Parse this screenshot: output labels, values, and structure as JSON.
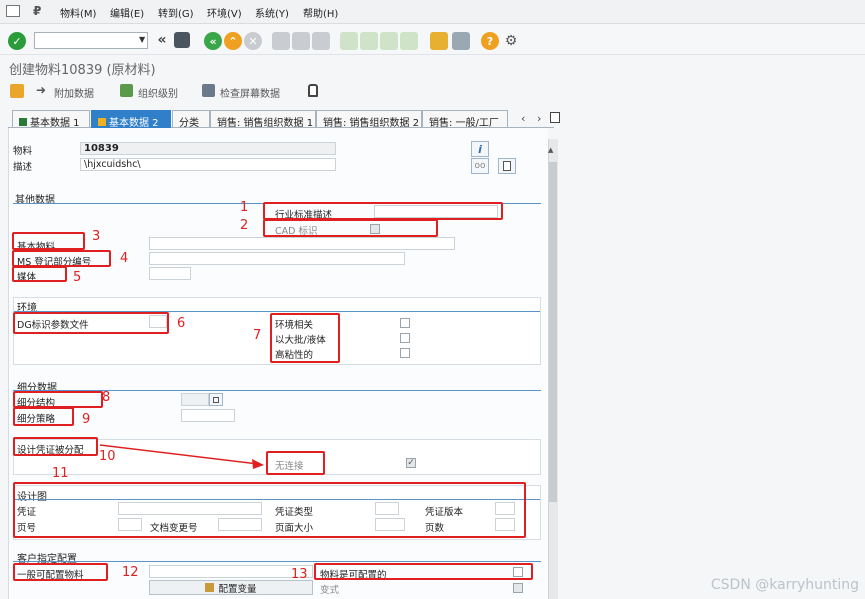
{
  "menu": {
    "items": [
      "物料(M)",
      "编辑(E)",
      "转到(G)",
      "环境(V)",
      "系统(Y)",
      "帮助(H)"
    ]
  },
  "window": {
    "title": "创建物料10839 (原材料)"
  },
  "app_toolbar": {
    "additional_data": "附加数据",
    "org_levels": "组织级别",
    "check_screen_data": "检查屏幕数据"
  },
  "tabs": [
    {
      "label": "基本数据 1",
      "active": false
    },
    {
      "label": "基本数据 2",
      "active": true
    },
    {
      "label": "分类",
      "active": false
    },
    {
      "label": "销售: 销售组织数据 1",
      "active": false
    },
    {
      "label": "销售: 销售组织数据 2",
      "active": false
    },
    {
      "label": "销售: 一般/工厂",
      "active": false
    }
  ],
  "header": {
    "material_label": "物料",
    "material_value": "10839",
    "desc_label": "描述",
    "desc_value": "\\hjxcuidshc\\"
  },
  "other_data": {
    "section_title": "其他数据",
    "industry_std_desc": "行业标准描述",
    "cad_indicator": "CAD 标识",
    "basic_material": "基本物料",
    "ms_book_part_no": "MS 登记部分编号",
    "medium": "媒体"
  },
  "environment": {
    "section_title": "环境",
    "dg_profile": "DG标识参数文件",
    "env_relevant": "环境相关",
    "highly_viscous_liquid": "以大批/液体",
    "highly_viscous": "高粘性的"
  },
  "segmentation": {
    "section_title": "细分数据",
    "structure": "细分结构",
    "strategy": "细分策略"
  },
  "design_doc": {
    "assigned_label": "设计凭证被分配",
    "no_link": "无连接",
    "checked": true
  },
  "design_drawing": {
    "section_title": "设计图",
    "document": "凭证",
    "doc_type": "凭证类型",
    "doc_version": "凭证版本",
    "page_no": "页号",
    "doc_change_no": "文档变更号",
    "page_format": "页面大小",
    "num_pages": "页数"
  },
  "client_config": {
    "section_title": "客户指定配置",
    "general_config_material": "一般可配置物料",
    "material_is_configurable": "物料是可配置的",
    "config_variant_btn": "配置变量",
    "variant": "变式"
  },
  "annotations": {
    "numbers": [
      "1",
      "2",
      "3",
      "4",
      "5",
      "6",
      "7",
      "8",
      "9",
      "10",
      "11",
      "12",
      "13"
    ]
  },
  "watermark": "CSDN @karryhunting",
  "colors": {
    "accent": "#2f7fc9",
    "annotation": "#e02020",
    "section_line": "#5b93c9"
  }
}
